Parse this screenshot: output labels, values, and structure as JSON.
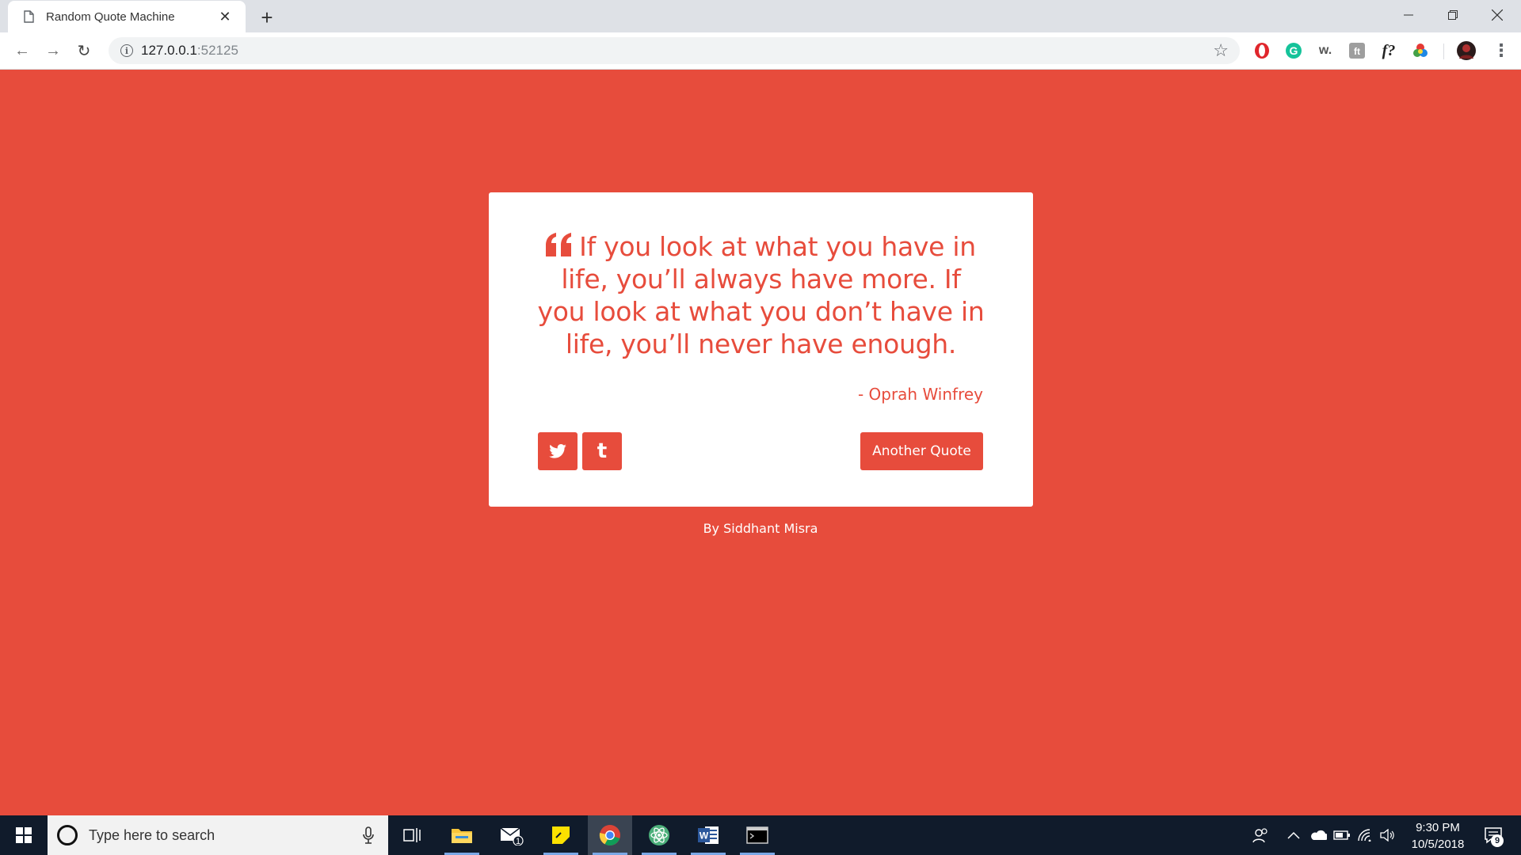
{
  "browser": {
    "tab": {
      "title": "Random Quote Machine",
      "close_glyph": "✕",
      "icon": "document-icon"
    },
    "new_tab_glyph": "+",
    "window_controls": {
      "minimize": "—",
      "restore": "❐",
      "close": "✕"
    },
    "nav": {
      "back": "←",
      "forward": "→",
      "reload": "↻"
    },
    "address": {
      "host": "127.0.0.1",
      "port": ":52125",
      "info_glyph": "i"
    },
    "bookmark_glyph": "☆",
    "extensions": [
      {
        "name": "opera-extension-icon",
        "glyph": "O",
        "color": "#e0262c"
      },
      {
        "name": "grammarly-extension-icon",
        "glyph": "G",
        "color": "#15c39a"
      },
      {
        "name": "wordtune-extension-icon",
        "glyph": "w.",
        "color": "#555555"
      },
      {
        "name": "translate-extension-icon",
        "glyph": "ft",
        "color": "#8a8a8a"
      },
      {
        "name": "font-extension-icon",
        "glyph": "f?",
        "color": "#222222"
      },
      {
        "name": "colorpicker-extension-icon",
        "glyph": "●",
        "color": "#e6a100"
      }
    ],
    "menu_glyph": "⋮"
  },
  "page": {
    "background": "#e74c3c",
    "quote": {
      "text": "If you look at what you have in life, you’ll always have more. If you look at what you don’t have in life, you’ll never have enough.",
      "author": "- Oprah Winfrey"
    },
    "share": {
      "twitter_glyph": "twitter",
      "tumblr_glyph": "t"
    },
    "another_quote_label": "Another Quote",
    "byline": {
      "prefix": "By ",
      "author": "Siddhant Misra"
    }
  },
  "taskbar": {
    "search_placeholder": "Type here to search",
    "mail_badge": "1",
    "clock_time": "9:30 PM",
    "clock_date": "10/5/2018",
    "notification_count": "9",
    "apps": [
      "task-view",
      "file-explorer",
      "mail",
      "sticky-notes",
      "chrome",
      "atom",
      "word",
      "terminal"
    ]
  }
}
